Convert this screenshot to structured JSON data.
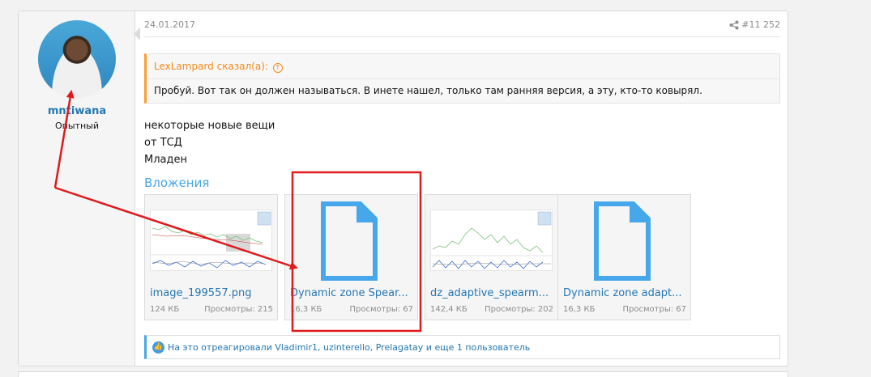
{
  "user": {
    "name": "mntiwana",
    "title": "Опытный"
  },
  "post": {
    "date": "24.01.2017",
    "number": "#11 252"
  },
  "quote": {
    "author": "LexLampard сказал(а):",
    "up_icon": "arrow-up-icon",
    "text": "Пробуй. Вот так он должен называться. В инете нашел, только там ранняя версия, а эту, кто-то ковырял."
  },
  "body": {
    "line1": "некоторые новые вещи",
    "line2": "от ТСД",
    "line3": "Младен"
  },
  "attachments": {
    "title": "Вложения",
    "items": [
      {
        "name": "image_199557.png",
        "size": "124 КБ",
        "views": "Просмотры: 215"
      },
      {
        "name": "Dynamic zone Spear...",
        "size": "16,3 КБ",
        "views": "Просмотры: 67"
      },
      {
        "name": "dz_adaptive_spearm...",
        "size": "142,4 КБ",
        "views": "Просмотры: 202"
      },
      {
        "name": "Dynamic zone adapt...",
        "size": "16,3 КБ",
        "views": "Просмотры: 67"
      }
    ]
  },
  "reactions": {
    "text": "На это отреагировали Vladimir1, uzinterello, Prelagatay и еще 1 пользователь"
  },
  "colors": {
    "link": "#2577b1",
    "accent": "#47a7eb",
    "quote_border": "#f9a033",
    "annotation": "#e0191b"
  }
}
